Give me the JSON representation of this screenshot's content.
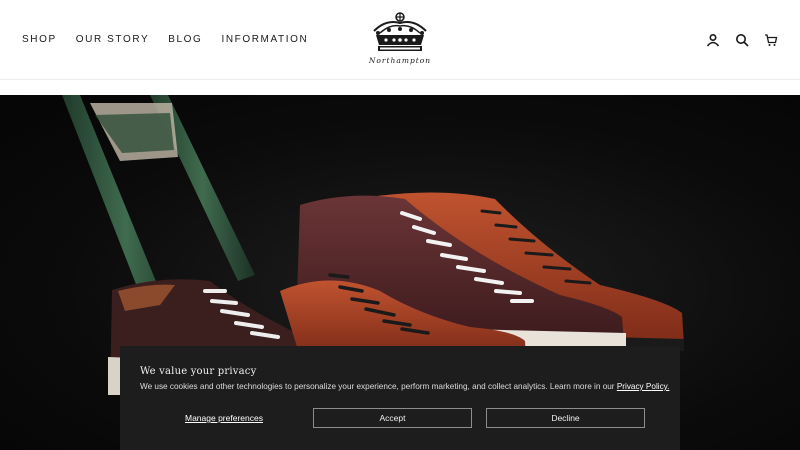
{
  "header": {
    "nav": [
      {
        "label": "SHOP"
      },
      {
        "label": "OUR STORY"
      },
      {
        "label": "BLOG"
      },
      {
        "label": "INFORMATION"
      }
    ],
    "logo_text": "Northampton",
    "icons": [
      "account-icon",
      "search-icon",
      "cart-icon"
    ]
  },
  "cookie_banner": {
    "title": "We value your privacy",
    "body": "We use cookies and other technologies to personalize your experience, perform marketing, and collect analytics. Learn more in our ",
    "policy_link": "Privacy Policy.",
    "manage_label": "Manage preferences",
    "accept_label": "Accept",
    "decline_label": "Decline"
  },
  "colors": {
    "hero_bg": "#0b0b0b",
    "banner_bg": "#1d1d1d",
    "shoe_burgundy": "#5a2a2d",
    "shoe_tan": "#a8432a"
  }
}
